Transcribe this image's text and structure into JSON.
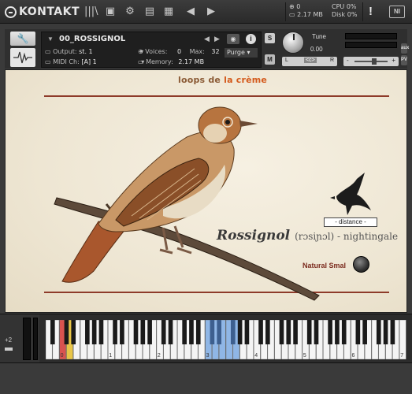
{
  "topbar": {
    "app_name": "KONTAKT",
    "voices_count": "0",
    "memory": "2.17 MB",
    "cpu_label": "CPU",
    "cpu_value": "0%",
    "disk_label": "Disk",
    "disk_value": "0%",
    "warning": "!",
    "ni_logo": "NI"
  },
  "instrument": {
    "name": "00_ROSSIGNOL",
    "output_label": "Output:",
    "output_value": "st. 1",
    "voices_label": "Voices:",
    "voices_value": "0",
    "max_label": "Max:",
    "max_value": "32",
    "purge_label": "Purge",
    "midi_label": "MIDI Ch:",
    "midi_value": "[A] 1",
    "memory_label": "Memory:",
    "memory_value": "2.17 MB",
    "solo": "S",
    "mute": "M",
    "tune_label": "Tune",
    "tune_value": "0.00",
    "pan_left": "L",
    "pan_right": "R",
    "pan_center": "<c>",
    "vol_minus": "-",
    "vol_plus": "+",
    "aux": "aux",
    "pv": "PV"
  },
  "panel": {
    "brand_part1": "loops de ",
    "brand_part2": "la crème",
    "distance_label": "- distance -",
    "title_main": "Rossignol",
    "title_sub": "(rɔsiɲɔl) - nightingale",
    "natural_label": "Natural Smal"
  },
  "keyboard": {
    "octave_shift": "+2",
    "octave_labels": [
      "0",
      "1",
      "2",
      "3",
      "4",
      "5",
      "6",
      "7"
    ],
    "highlight_colors": {
      "green": "#2e8b3a",
      "red": "#d9534f",
      "yellow": "#e8c547",
      "blue": "#8fb6e6"
    }
  }
}
